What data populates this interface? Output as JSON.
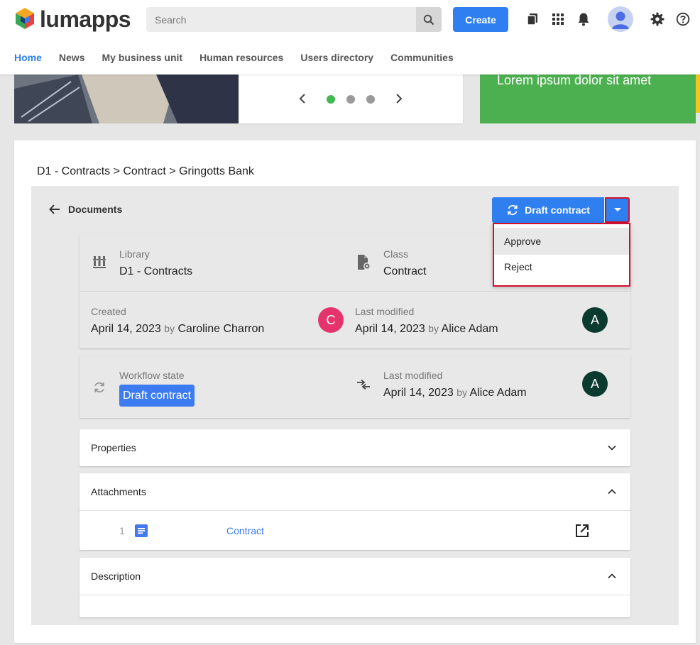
{
  "header": {
    "logo_text": "lumapps",
    "search_placeholder": "Search",
    "create_label": "Create",
    "nav": [
      {
        "label": "Home",
        "active": true
      },
      {
        "label": "News"
      },
      {
        "label": "My business unit"
      },
      {
        "label": "Human resources"
      },
      {
        "label": "Users directory"
      },
      {
        "label": "Communities"
      }
    ]
  },
  "banner": {
    "headline": "Lorem ipsum dolor sit amet",
    "slides": 3,
    "active_slide": 1
  },
  "breadcrumb": "D1 - Contracts > Contract > Gringotts Bank",
  "documents": {
    "back_label": "Documents",
    "workflow_button": "Draft contract",
    "menu": [
      {
        "label": "Approve"
      },
      {
        "label": "Reject"
      }
    ],
    "library_label": "Library",
    "library_value": "D1 - Contracts",
    "class_label": "Class",
    "class_value": "Contract",
    "created_label": "Created",
    "created_date": "April 14, 2023",
    "created_by_word": "by",
    "created_by": "Caroline Charron",
    "created_avatar": "C",
    "modified_label": "Last modified",
    "modified_date": "April 14, 2023",
    "modified_by_word": "by",
    "modified_by": "Alice Adam",
    "modified_avatar": "A",
    "workflow_label": "Workflow state",
    "workflow_state": "Draft contract",
    "wf_modified_label": "Last modified",
    "wf_modified_date": "April 14, 2023",
    "wf_modified_by_word": "by",
    "wf_modified_by": "Alice Adam",
    "wf_modified_avatar": "A"
  },
  "sections": {
    "properties": "Properties",
    "attachments": "Attachments",
    "description": "Description"
  },
  "attachments": [
    {
      "index": "1",
      "name": "Contract"
    }
  ],
  "colors": {
    "primary": "#2f7ff1",
    "highlight_border": "#d0102e",
    "green_banner": "#4caf50",
    "avatar_c": "#e5346c",
    "avatar_a": "#0b3b2e"
  }
}
